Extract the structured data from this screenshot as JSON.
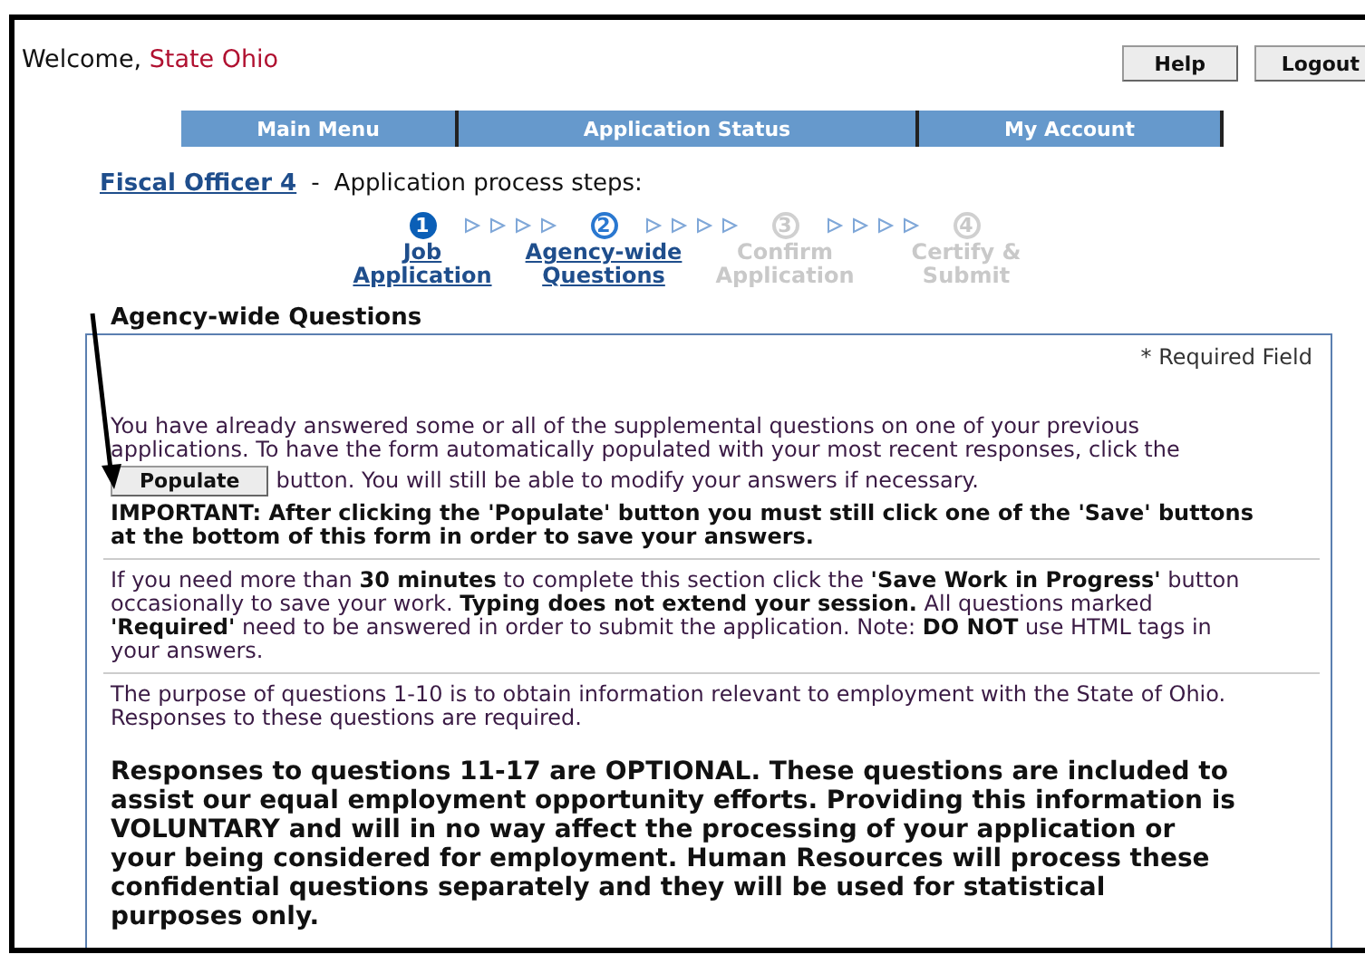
{
  "header": {
    "welcome": "Welcome,",
    "user": "State Ohio",
    "buttons": [
      "Help",
      "Logout"
    ]
  },
  "nav": [
    "Main Menu",
    "Application Status",
    "My Account"
  ],
  "breadcrumb": {
    "link": "Fiscal Officer 4",
    "separator": "-",
    "text": "Application process steps:"
  },
  "steps": [
    {
      "number": "1",
      "label": "Job Application",
      "completed": true,
      "selected": false
    },
    {
      "number": "2",
      "label": "Agency-wide Questions",
      "completed": false,
      "selected": true
    },
    {
      "number": "3",
      "label": "Confirm Application",
      "completed": false,
      "selected": false
    },
    {
      "number": "4",
      "label": "Certify & Submit",
      "completed": false,
      "selected": false
    }
  ],
  "section_title": "Agency-wide Questions",
  "required_note": "* Required Field",
  "populate": {
    "before": "You have already answered some or all of the supplemental questions on one of your previous applications. To have the form automatically populated with your most recent responses, click the",
    "button": "Populate",
    "after": "button. You will still be able to modify your answers if necessary."
  },
  "important": "IMPORTANT: After clicking the 'Populate' button you must still click one of the 'Save' buttons at the bottom of this form in order to save your answers.",
  "notes": [
    "If you need more than **30 minutes** to complete this section click the **'Save Work in Progress'** button occasionally to save your work. **Typing does not extend your session.** All questions marked **'Required'** need to be answered in order to submit the application. Note: **DO NOT** use HTML tags in your answers.",
    "The purpose of questions 1-10 is to obtain information relevant to employment with the State of Ohio. Responses to these questions are required."
  ],
  "optional_notice": "Responses to questions 11-17 are OPTIONAL. These questions are included to assist our equal employment opportunity efforts. Providing this information is VOLUNTARY and will in no way affect the processing of your application or your being considered for employment. Human Resources will process these confidential questions separately and they will be used for statistical purposes only."
}
